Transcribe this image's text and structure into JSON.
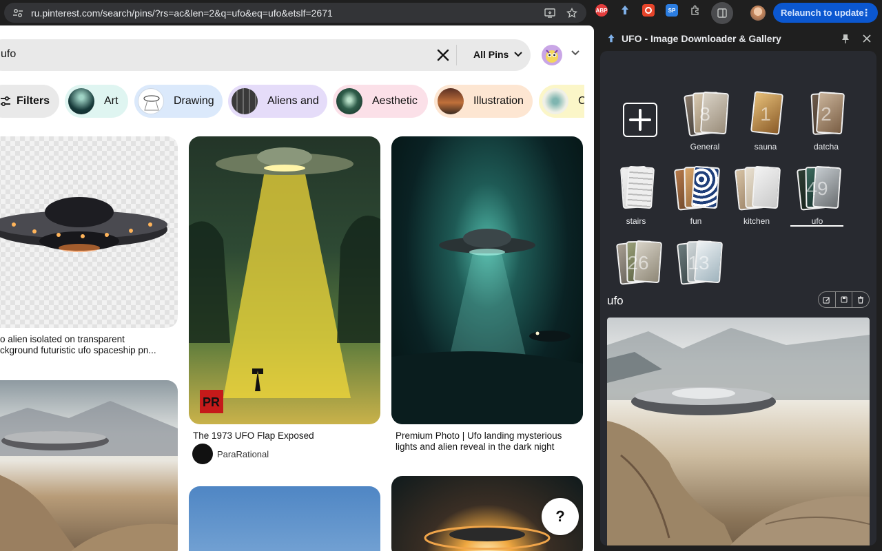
{
  "browser": {
    "url": "ru.pinterest.com/search/pins/?rs=ac&len=2&q=ufo&eq=ufo&etslf=2671",
    "relaunch_label": "Relaunch to update",
    "ext_labels": [
      "ABP",
      "SP"
    ]
  },
  "search": {
    "query": "ufo",
    "scope": "All Pins"
  },
  "chips": [
    {
      "label": "Filters"
    },
    {
      "label": "Art"
    },
    {
      "label": "Drawing"
    },
    {
      "label": "Aliens and"
    },
    {
      "label": "Aesthetic"
    },
    {
      "label": "Illustration"
    },
    {
      "label": "Ca"
    }
  ],
  "pins": [
    {
      "title_line1": "o alien isolated on transparent",
      "title_line2": "ckground futuristic ufo spaceship pn..."
    },
    {
      "title": "The 1973 UFO Flap Exposed",
      "author": "ParaRational",
      "badge": "PR"
    },
    {
      "title_line1": "Premium Photo | Ufo landing mysterious",
      "title_line2": "lights and alien reveal in the dark night"
    }
  ],
  "help_label": "?",
  "panel": {
    "title": "UFO - Image Downloader & Gallery",
    "albums": [
      {
        "label": "General",
        "count": "8"
      },
      {
        "label": "sauna",
        "count": "1"
      },
      {
        "label": "datcha",
        "count": "2"
      },
      {
        "label": "stairs",
        "count": ""
      },
      {
        "label": "fun",
        "count": ""
      },
      {
        "label": "kitchen",
        "count": ""
      },
      {
        "label": "ufo",
        "count": "49"
      },
      {
        "label": "",
        "count": "26"
      },
      {
        "label": "",
        "count": "13"
      }
    ],
    "gallery_title": "ufo"
  },
  "colors": {
    "relaunch_bg": "#0b57d0",
    "chip_art": "#dff5f1",
    "chip_drawing": "#dbe9fb",
    "chip_aliens": "#e5dcf9",
    "chip_aesthetic": "#fbe0e8",
    "chip_illustration": "#fde6d2",
    "chip_last": "#fbf6c8"
  }
}
